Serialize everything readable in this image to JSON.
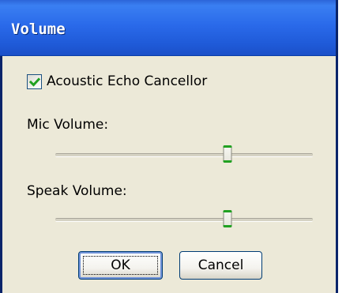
{
  "window": {
    "title": "Volume"
  },
  "aec": {
    "label": "Acoustic Echo Cancellor",
    "checked": true
  },
  "mic": {
    "label": "Mic Volume:",
    "value_fraction": 0.67
  },
  "speak": {
    "label": "Speak Volume:",
    "value_fraction": 0.67
  },
  "buttons": {
    "ok": "OK",
    "cancel": "Cancel"
  },
  "colors": {
    "titlebar": "#2a6aea",
    "dialog_bg": "#ece9d8",
    "check_green": "#21a121",
    "thumb_accent": "#21a121"
  }
}
